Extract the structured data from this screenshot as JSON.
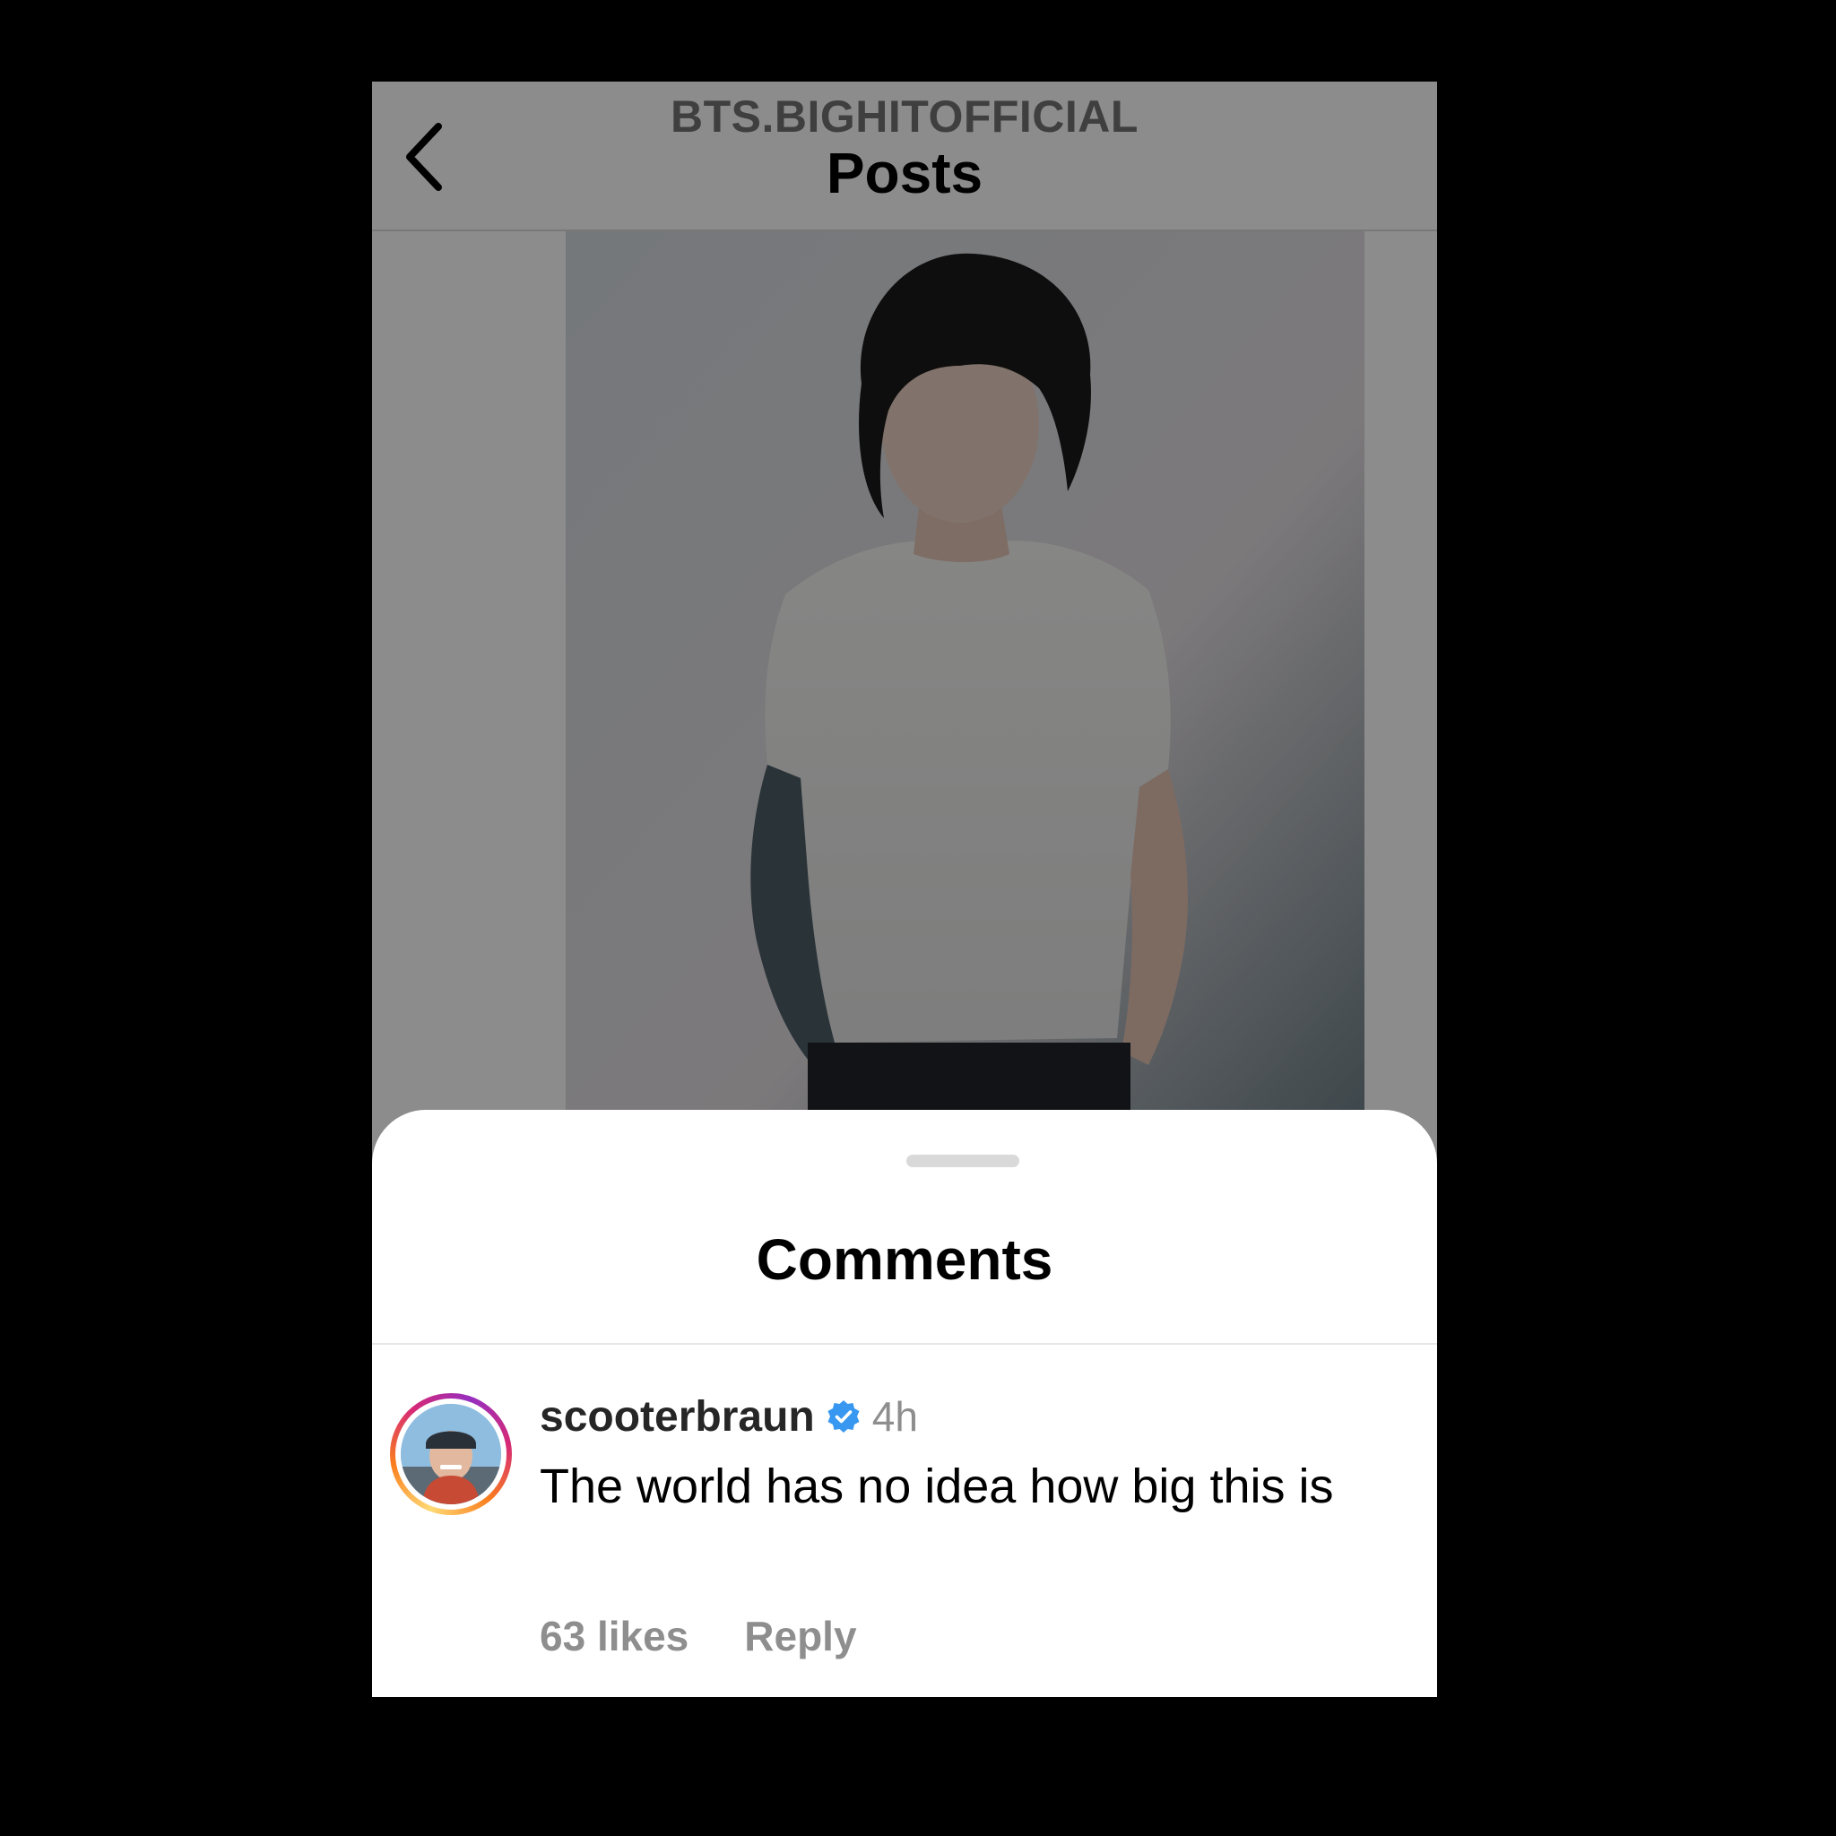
{
  "header": {
    "username": "BTS.BIGHITOFFICIAL",
    "title": "Posts",
    "back_icon": "chevron-left-icon"
  },
  "post": {
    "image_description_icon": "post-photo"
  },
  "sheet": {
    "title": "Comments"
  },
  "comment": {
    "username": "scooterbraun",
    "verified_icon": "verified-badge-icon",
    "time": "4h",
    "text": "The world has no idea how big this is",
    "likes": "63 likes",
    "reply_label": "Reply"
  },
  "colors": {
    "background": "#000000",
    "verified": "#3897f0",
    "secondary_text": "#8e8e8e",
    "primary_text": "#000000"
  }
}
